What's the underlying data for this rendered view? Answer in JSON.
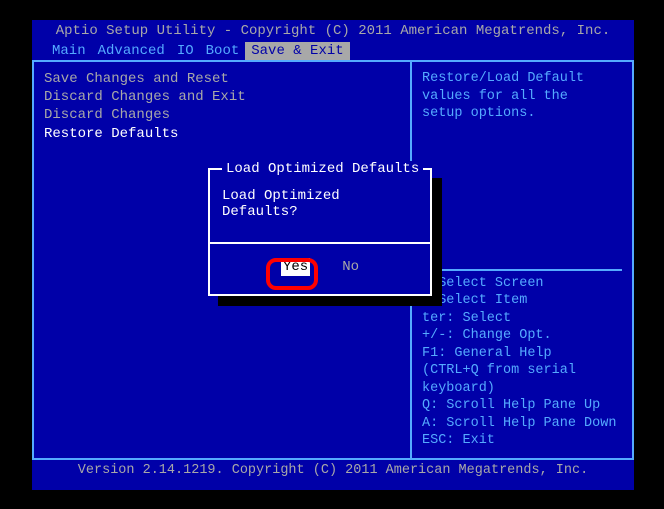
{
  "header": "Aptio Setup Utility - Copyright (C) 2011 American Megatrends, Inc.",
  "footer": "Version 2.14.1219. Copyright (C) 2011 American Megatrends, Inc.",
  "tabs": {
    "items": [
      "Main",
      "Advanced",
      "IO",
      "Boot",
      "Save & Exit"
    ],
    "active": "Save & Exit"
  },
  "menu": {
    "items": [
      {
        "label": "Save Changes and Reset",
        "selected": false
      },
      {
        "label": "Discard Changes and Exit",
        "selected": false
      },
      {
        "label": "Discard Changes",
        "selected": false
      },
      {
        "label": "Restore Defaults",
        "selected": true
      }
    ]
  },
  "help": {
    "line1": "Restore/Load Default",
    "line2": "values for all the",
    "line3": "setup options."
  },
  "legend": {
    "l1": ": Select Screen",
    "l2": ": Select Item",
    "l3": "ter: Select",
    "l4": "+/-: Change Opt.",
    "l5": "F1: General Help",
    "l6": "(CTRL+Q from serial",
    "l7": "keyboard)",
    "l8": "Q: Scroll Help Pane Up",
    "l9": "A: Scroll Help Pane Down",
    "l10": "ESC: Exit"
  },
  "dialog": {
    "title": "Load Optimized Defaults",
    "question": "Load Optimized Defaults?",
    "yes": "Yes",
    "no": "No"
  }
}
